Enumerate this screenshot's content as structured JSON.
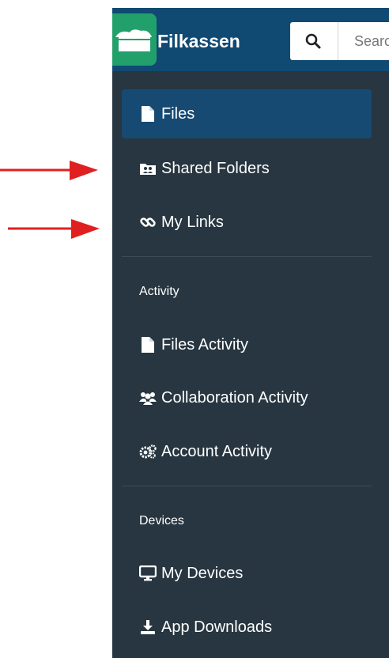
{
  "app": {
    "name": "Filkassen",
    "logo_icon": "cloud-folder-icon",
    "brand_color": "#22A06B",
    "header_color": "#104A73"
  },
  "search": {
    "button_icon": "search-icon",
    "placeholder": "Search"
  },
  "sidebar": {
    "background": "#273640",
    "active_color": "#174A72",
    "items": [
      {
        "label": "Files",
        "icon": "file-icon",
        "active": true
      },
      {
        "label": "Shared Folders",
        "icon": "shared-folder-icon",
        "active": false
      },
      {
        "label": "My Links",
        "icon": "link-icon",
        "active": false
      }
    ],
    "sections": [
      {
        "title": "Activity",
        "items": [
          {
            "label": "Files Activity",
            "icon": "file-icon"
          },
          {
            "label": "Collaboration Activity",
            "icon": "users-icon"
          },
          {
            "label": "Account Activity",
            "icon": "cogs-icon"
          }
        ]
      },
      {
        "title": "Devices",
        "items": [
          {
            "label": "My Devices",
            "icon": "desktop-icon"
          },
          {
            "label": "App Downloads",
            "icon": "download-icon"
          }
        ]
      }
    ]
  },
  "annotations": {
    "arrow_color": "#E02020",
    "arrows": [
      {
        "points_to": "Shared Folders"
      },
      {
        "points_to": "My Links"
      }
    ]
  }
}
